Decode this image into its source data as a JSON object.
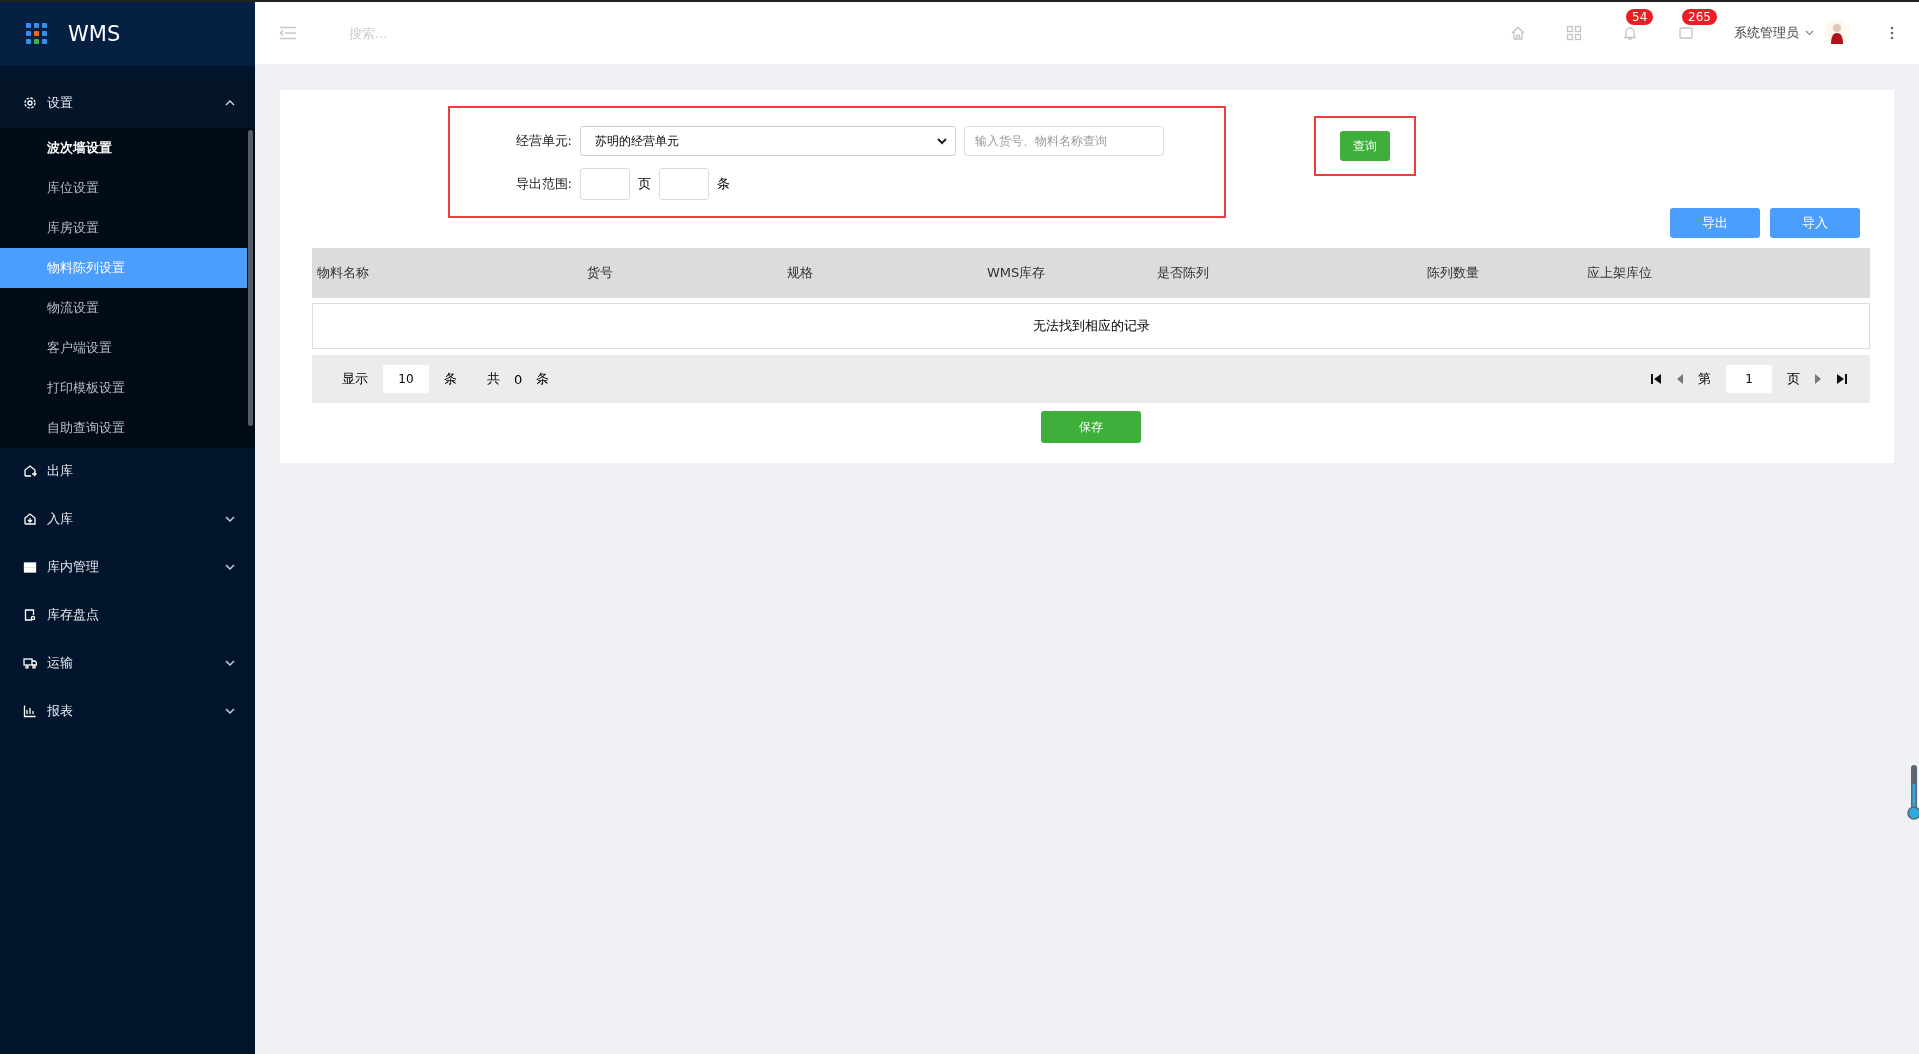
{
  "app": {
    "title": "WMS"
  },
  "sidebar": {
    "menu": [
      {
        "label": "设置",
        "has_submenu": true,
        "expanded": true,
        "children": [
          {
            "label": "波次墙设置",
            "selected": false,
            "hovered": true
          },
          {
            "label": "库位设置",
            "selected": false,
            "hovered": false
          },
          {
            "label": "库房设置",
            "selected": false,
            "hovered": false
          },
          {
            "label": "物料陈列设置",
            "selected": true,
            "hovered": false
          },
          {
            "label": "物流设置",
            "selected": false,
            "hovered": false
          },
          {
            "label": "客户端设置",
            "selected": false,
            "hovered": false
          },
          {
            "label": "打印模板设置",
            "selected": false,
            "hovered": false
          },
          {
            "label": "自助查询设置",
            "selected": false,
            "hovered": false
          }
        ]
      },
      {
        "label": "出库",
        "has_submenu": false,
        "expanded": false
      },
      {
        "label": "入库",
        "has_submenu": true,
        "expanded": false
      },
      {
        "label": "库内管理",
        "has_submenu": true,
        "expanded": false
      },
      {
        "label": "库存盘点",
        "has_submenu": false,
        "expanded": false
      },
      {
        "label": "运输",
        "has_submenu": true,
        "expanded": false
      },
      {
        "label": "报表",
        "has_submenu": true,
        "expanded": false
      }
    ]
  },
  "header": {
    "search": {
      "placeholder": "搜索..."
    },
    "notifications_badge": "54",
    "messages_badge": "265",
    "user": "系统管理员"
  },
  "filter": {
    "unit_label": "经营单元:",
    "unit_value": "苏明的经营单元",
    "keyword": {
      "placeholder": "输入货号、物料名称查询"
    },
    "range_label": "导出范围:",
    "page_unit": "页",
    "row_unit": "条",
    "query_button": "查询"
  },
  "actions": [
    "导出",
    "导入"
  ],
  "table": {
    "columns": [
      "物料名称",
      "货号",
      "规格",
      "WMS库存",
      "是否陈列",
      "陈列数量",
      "应上架库位"
    ],
    "empty_message": "无法找到相应的记录"
  },
  "pager": {
    "show_label": "显示",
    "page_size": "10",
    "size_unit": "条",
    "total_label": "共",
    "total": "0",
    "total_unit": "条",
    "page_label": "第",
    "page": "1",
    "page_unit": "页"
  },
  "save_button": "保存"
}
